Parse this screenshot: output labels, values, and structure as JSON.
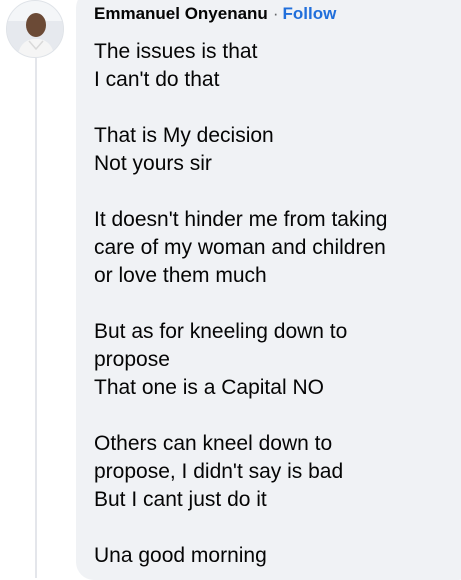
{
  "comment": {
    "author": "Emmanuel Onyenanu",
    "separator": "·",
    "follow_label": "Follow",
    "paragraphs": [
      [
        "The issues is that",
        "I can't do that"
      ],
      [
        "That is My decision",
        "Not yours sir"
      ],
      [
        "It doesn't hinder me from taking",
        "care of my woman and children",
        "or love them much"
      ],
      [
        "But as for kneeling down to",
        "propose",
        "That one is a Capital NO"
      ],
      [
        "Others can kneel down to",
        "propose, I didn't say is bad",
        "But I cant just do it"
      ],
      [
        "Una good morning"
      ]
    ]
  },
  "colors": {
    "bubble_bg": "#f0f2f5",
    "text": "#050505",
    "follow": "#216fdb",
    "thread_line": "#e4e6eb"
  },
  "icons": {
    "avatar": "profile-photo-icon"
  }
}
